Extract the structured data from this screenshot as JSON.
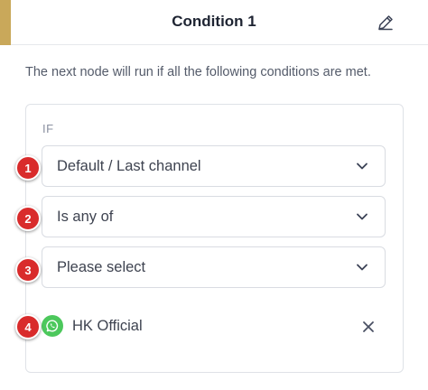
{
  "header": {
    "title": "Condition 1",
    "accent_color": "#c9a85a",
    "edit_icon": "pencil-icon"
  },
  "description": "The next node will run if all the following conditions are met.",
  "condition": {
    "if_label": "IF",
    "channel_select": {
      "value": "Default / Last channel"
    },
    "operator_select": {
      "value": "Is any of"
    },
    "value_select": {
      "placeholder": "Please select"
    },
    "selected_channel": {
      "name": "HK Official",
      "icon": "whatsapp-icon",
      "icon_color": "#4cc85c"
    }
  },
  "badges": [
    "1",
    "2",
    "3",
    "4"
  ],
  "badge_color": "#d92b2b"
}
